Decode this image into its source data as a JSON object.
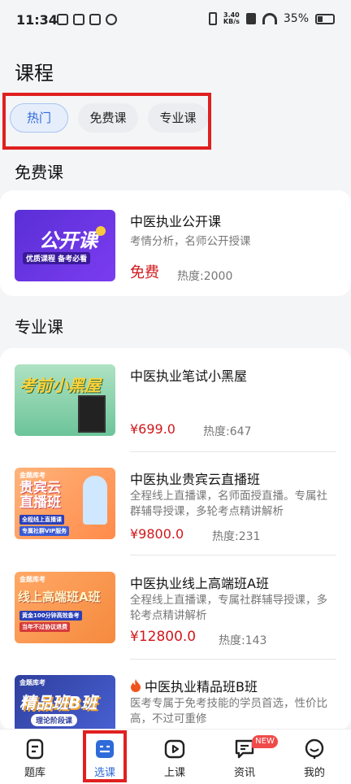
{
  "status_bar": {
    "time": "11:34",
    "net_speed_value": "3.40",
    "net_speed_unit": "KB/s",
    "battery": "35%"
  },
  "page": {
    "title": "课程"
  },
  "tabs": [
    {
      "label": "热门",
      "active": true
    },
    {
      "label": "免费课",
      "active": false
    },
    {
      "label": "专业课",
      "active": false
    }
  ],
  "sections": {
    "free": {
      "title": "免费课",
      "courses": [
        {
          "title": "中医执业公开课",
          "desc": "考情分析，名师公开授课",
          "price": "免费",
          "heat": "热度:2000",
          "thumb_text": "公开课",
          "thumb_sub": "优质课程 备考必看"
        }
      ]
    },
    "pro": {
      "title": "专业课",
      "courses": [
        {
          "title": "中医执业笔试小黑屋",
          "desc": "",
          "price": "¥699.0",
          "heat": "热度:647",
          "thumb_text": "考前小黑屋"
        },
        {
          "title": "中医执业贵宾云直播班",
          "desc": "全程线上直播课，名师面授直播。专属社群辅导授课，多轮考点精讲解析",
          "price": "¥9800.0",
          "heat": "热度:231",
          "thumb_text": "贵宾云直播班",
          "thumb_sub": "全程线上直播课",
          "thumb_sub2": "专属社群VIP服务",
          "brand": "金题库考"
        },
        {
          "title": "中医执业线上高端班A班",
          "desc": "全程线上直播课，专属社群辅导授课，多轮考点精讲解析",
          "price": "¥12800.0",
          "heat": "热度:143",
          "thumb_text": "线上高端班A班",
          "thumb_sub": "黄金100分钟高效备考",
          "thumb_sub2": "当年不过协议退费",
          "brand": "金题库考"
        },
        {
          "title": "中医执业精品班B班",
          "desc": "医考专属于免考技能的学员首选，性价比高，不过可重修",
          "price": "",
          "heat": "",
          "thumb_text": "精品班B班",
          "thumb_sub": "理论阶段课",
          "brand": "金题库考",
          "hot_icon": "fire-icon"
        }
      ]
    }
  },
  "bottom_nav": [
    {
      "label": "题库",
      "icon": "question-bank-icon",
      "active": false
    },
    {
      "label": "选课",
      "icon": "course-select-icon",
      "active": true
    },
    {
      "label": "上课",
      "icon": "play-icon",
      "active": false
    },
    {
      "label": "资讯",
      "icon": "news-icon",
      "active": false,
      "badge": "NEW"
    },
    {
      "label": "我的",
      "icon": "profile-icon",
      "active": false
    }
  ],
  "colors": {
    "accent": "#2f6ad9",
    "price": "#d0181c",
    "highlight_box": "#e02020"
  }
}
